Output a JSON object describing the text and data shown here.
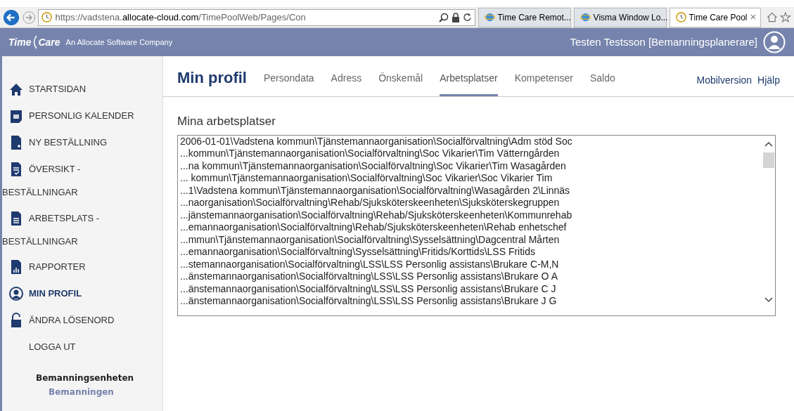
{
  "browser": {
    "address": {
      "prefix": "https://vadstena.",
      "domain": "allocate-cloud.com",
      "path": "/TimePoolWeb/Pages/Con"
    },
    "tabs": [
      {
        "label": "Time Care Remot...",
        "selected": false,
        "kind": "ie"
      },
      {
        "label": "Visma Window Lo...",
        "selected": false,
        "kind": "ie"
      },
      {
        "label": "Time Care Pool",
        "selected": true,
        "kind": "clock"
      }
    ],
    "close_glyph": "×"
  },
  "header": {
    "logo_left": "Time",
    "logo_right": "Care",
    "tagline": "An Allocate Software Company",
    "user": "Testen Testsson [Bemanningsplanerare]"
  },
  "sidebar": {
    "items": [
      {
        "label": "STARTSIDAN",
        "selected": false
      },
      {
        "label": "PERSONLIG KALENDER",
        "selected": false
      },
      {
        "label": "NY BESTÄLLNING",
        "selected": false
      },
      {
        "label": "ÖVERSIKT -",
        "continuation": "BESTÄLLNINGAR",
        "selected": false
      },
      {
        "label": "ARBETSPLATS -",
        "continuation": "BESTÄLLNINGAR",
        "selected": false
      },
      {
        "label": "RAPPORTER",
        "selected": false
      },
      {
        "label": "MIN PROFIL",
        "selected": true
      },
      {
        "label": "ÄNDRA LÖSENORD",
        "selected": false
      },
      {
        "label": "LOGGA UT",
        "selected": false
      }
    ],
    "unit": "Bemanningsenheten",
    "unit_sub": "Bemanningen"
  },
  "page": {
    "title": "Min profil",
    "tabs": [
      {
        "label": "Persondata",
        "selected": false
      },
      {
        "label": "Adress",
        "selected": false
      },
      {
        "label": "Önskemål",
        "selected": false
      },
      {
        "label": "Arbetsplatser",
        "selected": true
      },
      {
        "label": "Kompetenser",
        "selected": false
      },
      {
        "label": "Saldo",
        "selected": false
      }
    ],
    "links": [
      "Mobilversion",
      "Hjälp"
    ],
    "section_title": "Mina arbetsplatser",
    "workplaces": [
      "2006-01-01\\Vadstena kommun\\Tjänstemannaorganisation\\Socialförvaltning\\Adm stöd Soc",
      "...kommun\\Tjänstemannaorganisation\\Socialförvaltning\\Soc Vikarier\\Tim Vätterngården",
      "...na kommun\\Tjänstemannaorganisation\\Socialförvaltning\\Soc Vikarier\\Tim Wasagården",
      "... kommun\\Tjänstemannaorganisation\\Socialförvaltning\\Soc Vikarier\\Soc Vikarier Tim",
      "...1\\Vadstena kommun\\Tjänstemannaorganisation\\Socialförvaltning\\Wasagården 2\\Linnäs",
      "...naorganisation\\Socialförvaltning\\Rehab/Sjuksköterskeenheten\\Sjuksköterskegruppen",
      "...jänstemannaorganisation\\Socialförvaltning\\Rehab/Sjuksköterskeenheten\\Kommunrehab",
      "...emannaorganisation\\Socialförvaltning\\Rehab/Sjuksköterskeenheten\\Rehab enhetschef",
      "...mmun\\Tjänstemannaorganisation\\Socialförvaltning\\Sysselsättning\\Dagcentral Mårten",
      "...emannaorganisation\\Socialförvaltning\\Sysselsättning\\Fritids/Korttids\\LSS Fritids",
      "...stemannaorganisation\\Socialförvaltning\\LSS\\LSS Personlig assistans\\Brukare C-M,N",
      "...änstemannaorganisation\\Socialförvaltning\\LSS\\LSS Personlig assistans\\Brukare O A",
      "...änstemannaorganisation\\Socialförvaltning\\LSS\\LSS Personlig assistans\\Brukare C J",
      "...änstemannaorganisation\\Socialförvaltning\\LSS\\LSS Personlig assistans\\Brukare J G"
    ]
  }
}
